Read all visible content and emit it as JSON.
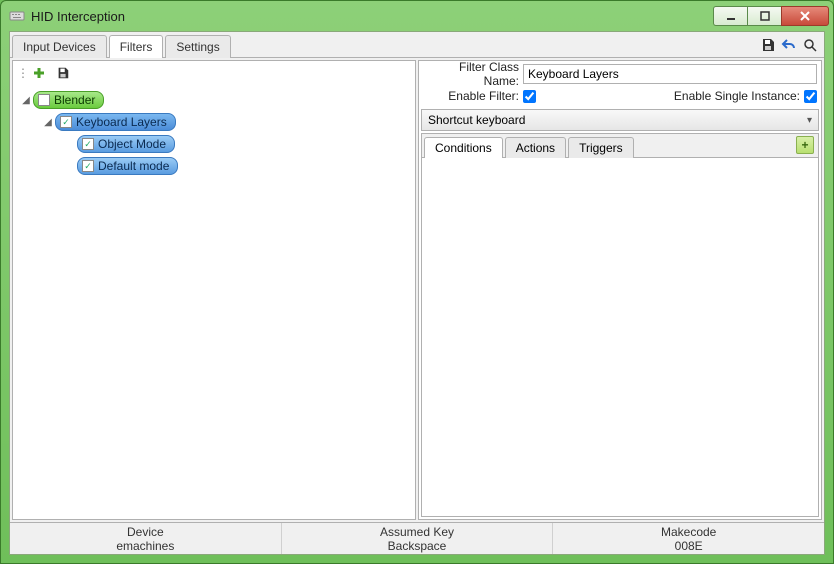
{
  "window": {
    "title": "HID Interception"
  },
  "tabs": {
    "input_devices": "Input Devices",
    "filters": "Filters",
    "settings": "Settings",
    "active": "filters"
  },
  "toolbar_icons": {
    "save": "save-icon",
    "undo": "undo-icon",
    "search": "search-icon"
  },
  "tree": {
    "root": {
      "label": "Blender",
      "checked": false,
      "children": [
        {
          "label": "Keyboard Layers",
          "checked": true,
          "selected": true,
          "children": [
            {
              "label": "Object Mode",
              "checked": true
            },
            {
              "label": "Default mode",
              "checked": true
            }
          ]
        }
      ]
    }
  },
  "form": {
    "filter_class_name_label": "Filter Class Name:",
    "filter_class_name_value": "Keyboard Layers",
    "enable_filter_label": "Enable Filter:",
    "enable_filter_checked": true,
    "enable_single_instance_label": "Enable Single Instance:",
    "enable_single_instance_checked": true
  },
  "section": {
    "header": "Shortcut keyboard"
  },
  "subtabs": {
    "conditions": "Conditions",
    "actions": "Actions",
    "triggers": "Triggers",
    "active": "conditions",
    "add": "+"
  },
  "status": {
    "device_label": "Device",
    "device_value": "emachines",
    "assumed_key_label": "Assumed Key",
    "assumed_key_value": "Backspace",
    "makecode_label": "Makecode",
    "makecode_value": "008E"
  }
}
